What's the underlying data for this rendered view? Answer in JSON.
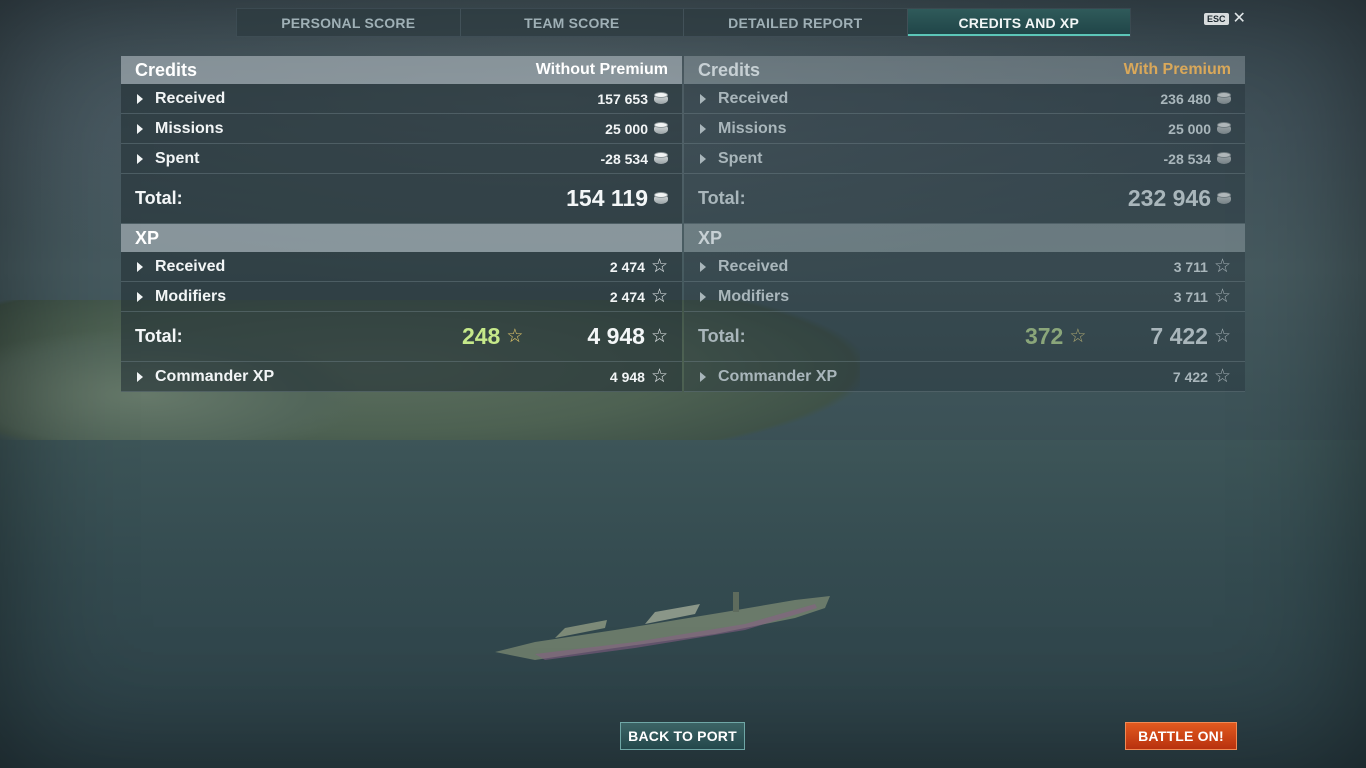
{
  "tabs": [
    {
      "label": "PERSONAL SCORE"
    },
    {
      "label": "TEAM SCORE"
    },
    {
      "label": "DETAILED REPORT"
    },
    {
      "label": "CREDITS AND XP",
      "active": true
    }
  ],
  "esc": {
    "key": "ESC",
    "close": "✕"
  },
  "without_premium": {
    "credits": {
      "title": "Credits",
      "subtitle": "Without Premium",
      "rows": [
        {
          "label": "Received",
          "value": "157 653"
        },
        {
          "label": "Missions",
          "value": "25 000"
        },
        {
          "label": "Spent",
          "value": "-28 534"
        }
      ],
      "total_label": "Total:",
      "total_value": "154 119"
    },
    "xp": {
      "title": "XP",
      "rows": [
        {
          "label": "Received",
          "value": "2 474"
        },
        {
          "label": "Modifiers",
          "value": "2 474"
        }
      ],
      "total_label": "Total:",
      "total_bonus": "248",
      "total_value": "4 948",
      "commander_label": "Commander XP",
      "commander_value": "4 948"
    }
  },
  "with_premium": {
    "credits": {
      "title": "Credits",
      "subtitle": "With Premium",
      "rows": [
        {
          "label": "Received",
          "value": "236 480"
        },
        {
          "label": "Missions",
          "value": "25 000"
        },
        {
          "label": "Spent",
          "value": "-28 534"
        }
      ],
      "total_label": "Total:",
      "total_value": "232 946"
    },
    "xp": {
      "title": "XP",
      "rows": [
        {
          "label": "Received",
          "value": "3 711"
        },
        {
          "label": "Modifiers",
          "value": "3 711"
        }
      ],
      "total_label": "Total:",
      "total_bonus": "372",
      "total_value": "7 422",
      "commander_label": "Commander XP",
      "commander_value": "7 422"
    }
  },
  "icons": {
    "credit": "credits-coin-icon",
    "xp": "star-icon",
    "expand": "caret-right-icon"
  },
  "colors": {
    "accent_tab": "#5cc6b8",
    "premium": "#d9a85a",
    "bonus_xp": "#c6e98a",
    "battle_button": "#e25a1f"
  },
  "buttons": {
    "back_to_port": "BACK TO PORT",
    "battle_on": "BATTLE ON!"
  }
}
